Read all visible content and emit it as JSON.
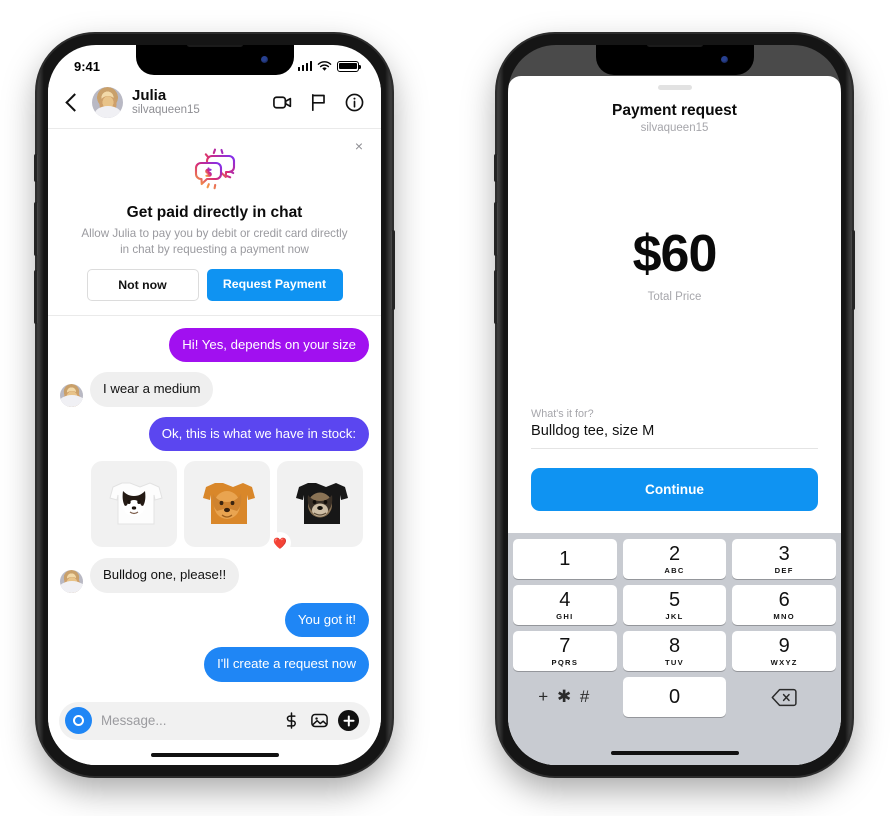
{
  "left_phone": {
    "status_bar": {
      "time": "9:41",
      "signal_icon": "cellular-bars-icon",
      "wifi_icon": "wifi-icon",
      "battery_icon": "battery-full-icon"
    },
    "header": {
      "back_icon": "chevron-left-icon",
      "avatar": "contact-avatar",
      "name": "Julia",
      "handle": "silvaqueen15",
      "icons": [
        "video-call-icon",
        "flag-icon",
        "info-icon"
      ]
    },
    "promo": {
      "close_label": "×",
      "icon": "chat-bubbles-dollar-icon",
      "title": "Get paid directly in chat",
      "subtitle": "Allow Julia to pay you by debit or credit card directly in chat by requesting a payment now",
      "secondary_button": "Not now",
      "primary_button": "Request Payment",
      "primary_color": "#0f93f2"
    },
    "messages": [
      {
        "id": "m1",
        "side": "out",
        "text": "Hi! Yes, depends on your size",
        "color": "#a110f0"
      },
      {
        "id": "m2",
        "side": "in",
        "text": "I wear a medium",
        "color": "#efefef"
      },
      {
        "id": "m3",
        "side": "out",
        "text": "Ok, this is what we have in stock:",
        "color": "#5b46f0"
      },
      {
        "id": "m4",
        "side": "in",
        "text": "Bulldog one, please!!",
        "color": "#efefef"
      },
      {
        "id": "m5",
        "side": "out",
        "text": "You got it!",
        "color": "#1f86f5"
      },
      {
        "id": "m6",
        "side": "out",
        "text": "I'll create a request now",
        "color": "#1f86f5"
      }
    ],
    "products": [
      {
        "id": "p1",
        "name": "border-collie-tee",
        "shirt_color": "#ffffff"
      },
      {
        "id": "p2",
        "name": "golden-retriever-tee",
        "shirt_color": "#d98b2b"
      },
      {
        "id": "p3",
        "name": "bulldog-tee",
        "shirt_color": "#1a1a1a",
        "badge": "❤️"
      }
    ],
    "composer": {
      "camera_icon": "camera-icon",
      "placeholder": "Message...",
      "dollar_icon": "dollar-sign-icon",
      "photo_icon": "photo-icon",
      "plus_icon": "plus-icon"
    }
  },
  "right_phone": {
    "sheet": {
      "grabber": "sheet-grabber",
      "title": "Payment request",
      "subtitle": "silvaqueen15",
      "amount": "$60",
      "amount_label": "Total Price",
      "purpose_label": "What's it for?",
      "purpose_value": "Bulldog tee, size M",
      "continue_label": "Continue",
      "continue_color": "#0f93f2"
    },
    "keypad": {
      "background": "#c8cbd1",
      "keys": [
        {
          "num": "1",
          "sub": ""
        },
        {
          "num": "2",
          "sub": "ABC"
        },
        {
          "num": "3",
          "sub": "DEF"
        },
        {
          "num": "4",
          "sub": "GHI"
        },
        {
          "num": "5",
          "sub": "JKL"
        },
        {
          "num": "6",
          "sub": "MNO"
        },
        {
          "num": "7",
          "sub": "PQRS"
        },
        {
          "num": "8",
          "sub": "TUV"
        },
        {
          "num": "9",
          "sub": "WXYZ"
        }
      ],
      "symbol_key": "+ ✱ #",
      "zero_key": "0",
      "backspace_icon": "backspace-icon"
    }
  }
}
